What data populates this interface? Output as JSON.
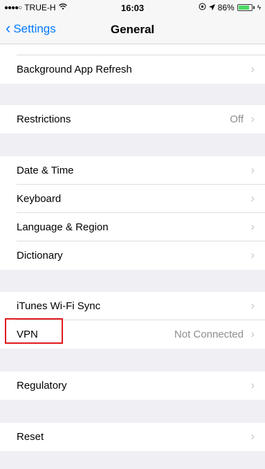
{
  "status_bar": {
    "signal": "●●●●○",
    "carrier": "TRUE-H",
    "wifi": "wifi-icon",
    "time": "16:03",
    "battery_text": "86%",
    "battery_level": 0.86
  },
  "nav": {
    "back_label": "Settings",
    "title": "General"
  },
  "sections": {
    "background_refresh": {
      "label": "Background App Refresh"
    },
    "restrictions": {
      "label": "Restrictions",
      "value": "Off"
    },
    "date_time": {
      "label": "Date & Time"
    },
    "keyboard": {
      "label": "Keyboard"
    },
    "language_region": {
      "label": "Language & Region"
    },
    "dictionary": {
      "label": "Dictionary"
    },
    "itunes_sync": {
      "label": "iTunes Wi-Fi Sync"
    },
    "vpn": {
      "label": "VPN",
      "value": "Not Connected"
    },
    "regulatory": {
      "label": "Regulatory"
    },
    "reset": {
      "label": "Reset"
    }
  },
  "chevron": "›"
}
